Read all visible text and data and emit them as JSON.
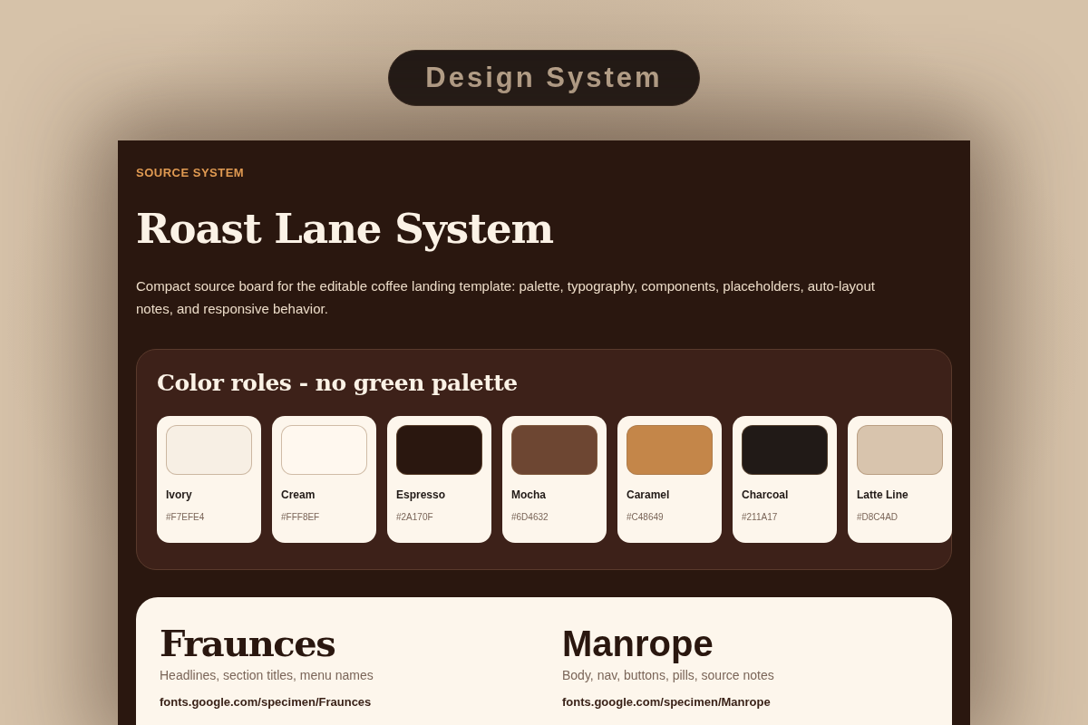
{
  "badge": "Design System",
  "board": {
    "eyebrow": "SOURCE SYSTEM",
    "title": "Roast Lane System",
    "description": "Compact source board for the editable coffee landing template: palette, typography, components, placeholders, auto-layout notes, and responsive behavior."
  },
  "palette": {
    "title": "Color roles - no green palette",
    "swatches": [
      {
        "name": "Ivory",
        "hex": "#F7EFE4",
        "color": "#f7efe4"
      },
      {
        "name": "Cream",
        "hex": "#FFF8EF",
        "color": "#fff8ef"
      },
      {
        "name": "Espresso",
        "hex": "#2A170F",
        "color": "#2a170f"
      },
      {
        "name": "Mocha",
        "hex": "#6D4632",
        "color": "#6d4632"
      },
      {
        "name": "Caramel",
        "hex": "#C48649",
        "color": "#c48649"
      },
      {
        "name": "Charcoal",
        "hex": "#211A17",
        "color": "#211a17"
      },
      {
        "name": "Latte Line",
        "hex": "#D8C4AD",
        "color": "#d8c4ad"
      }
    ]
  },
  "fonts": [
    {
      "kind": "serif",
      "name": "Fraunces",
      "usage": "Headlines, section titles, menu names",
      "link": "fonts.google.com/specimen/Fraunces"
    },
    {
      "kind": "sans",
      "name": "Manrope",
      "usage": "Body, nav, buttons, pills, source notes",
      "link": "fonts.google.com/specimen/Manrope"
    }
  ]
}
